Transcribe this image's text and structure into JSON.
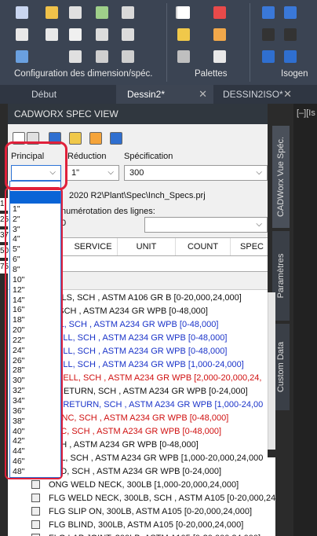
{
  "ribbon": {
    "group1_label": "Configuration des dimension/spéc.",
    "group2_label": "Palettes",
    "group3_label": "Isogen"
  },
  "tabs": [
    {
      "label": "Début"
    },
    {
      "label": "Dessin2*"
    },
    {
      "label": "DESSIN2ISO*"
    }
  ],
  "right_strip_text": "[–][Is",
  "palette": {
    "title": "CADWORX SPEC VIEW",
    "principal_label": "Principal",
    "reduction_label": "Réduction",
    "specification_label": "Spécification",
    "reduction_value": "1\"",
    "specification_value": "300",
    "path_text": "2020 R2\\Plant\\Spec\\Inch_Specs.prj",
    "numbering_label": "numérotation des lignes:",
    "numbering_left": "0",
    "grid_columns": [
      "SERVICE",
      "UNIT",
      "COUNT",
      "SPEC"
    ],
    "side_tabs": [
      "CADWorx Vue Spéc.",
      "Paramètres",
      "Custom Data"
    ]
  },
  "dropdown_options": [
    "",
    "1\"",
    "2\"",
    "3\"",
    "4\"",
    "5\"",
    "6\"",
    "8\"",
    "10\"",
    "12\"",
    "14\"",
    "16\"",
    "18\"",
    "20\"",
    "22\"",
    "24\"",
    "26\"",
    "28\"",
    "30\"",
    "32\"",
    "34\"",
    "36\"",
    "38\"",
    "40\"",
    "42\"",
    "44\"",
    "46\"",
    "48\""
  ],
  "left_partial_numbers": [
    "1",
    "25",
    "37",
    "50",
    "75"
  ],
  "items": [
    {
      "text": "SMLS, SCH , ASTM A106 GR B [0-20,000,24,000]",
      "color": "black"
    },
    {
      "text": "L, SCH , ASTM A234 GR WPB [0-48,000]",
      "color": "black"
    },
    {
      "text": "ELL, SCH , ASTM A234 GR WPB [0-48,000]",
      "color": "blue"
    },
    {
      "text": "R ELL, SCH , ASTM A234 GR WPB [0-48,000]",
      "color": "blue"
    },
    {
      "text": "R ELL, SCH , ASTM A234 GR WPB [0-48,000]",
      "color": "blue"
    },
    {
      "text": "R ELL, SCH , ASTM A234 GR WPB [1,000-24,000]",
      "color": "blue"
    },
    {
      "text": "ED ELL, SCH , ASTM A234 GR WPB [2,000-20,000,24,",
      "color": "red"
    },
    {
      "text": "R RETURN, SCH , ASTM A234 GR WPB [0-24,000]",
      "color": "black"
    },
    {
      "text": "SR RETURN, SCH , ASTM A234 GR WPB [1,000-24,00",
      "color": "blue"
    },
    {
      "text": "CONC, SCH , ASTM A234 GR WPB [0-48,000]",
      "color": "red"
    },
    {
      "text": "ECC, SCH , ASTM A234 GR WPB [0-48,000]",
      "color": "red"
    },
    {
      "text": "SCH , ASTM A234 GR WPB [0-48,000]",
      "color": "black"
    },
    {
      "text": "RAL, SCH , ASTM A234 GR WPB [1,000-20,000,24,000",
      "color": "black"
    },
    {
      "text": "END, SCH , ASTM A234 GR WPB [0-24,000]",
      "color": "black"
    },
    {
      "text": "ONG WELD NECK, 300LB [1,000-20,000,24,000]",
      "color": "black"
    },
    {
      "text": "FLG WELD NECK, 300LB, SCH , ASTM A105 [0-20,000,24,00",
      "color": "black"
    },
    {
      "text": "FLG SLIP ON, 300LB, ASTM A105 [0-20,000,24,000]",
      "color": "black"
    },
    {
      "text": "FLG BLIND, 300LB, ASTM A105 [0-20,000,24,000]",
      "color": "black"
    },
    {
      "text": "FLG LAP JOINT, 300LB, ASTM A105 [0-20,000,24,000]",
      "color": "black"
    },
    {
      "text": "FLG SW, 300LB, ASTM A105 [0-3,000]",
      "color": "black"
    }
  ],
  "colors": {
    "ribbon_bg": "#3b4453",
    "dropdown_selected": "#0a64d6",
    "highlight": "#e0203a",
    "blue_text": "#1a33c9",
    "red_text": "#d01010"
  }
}
